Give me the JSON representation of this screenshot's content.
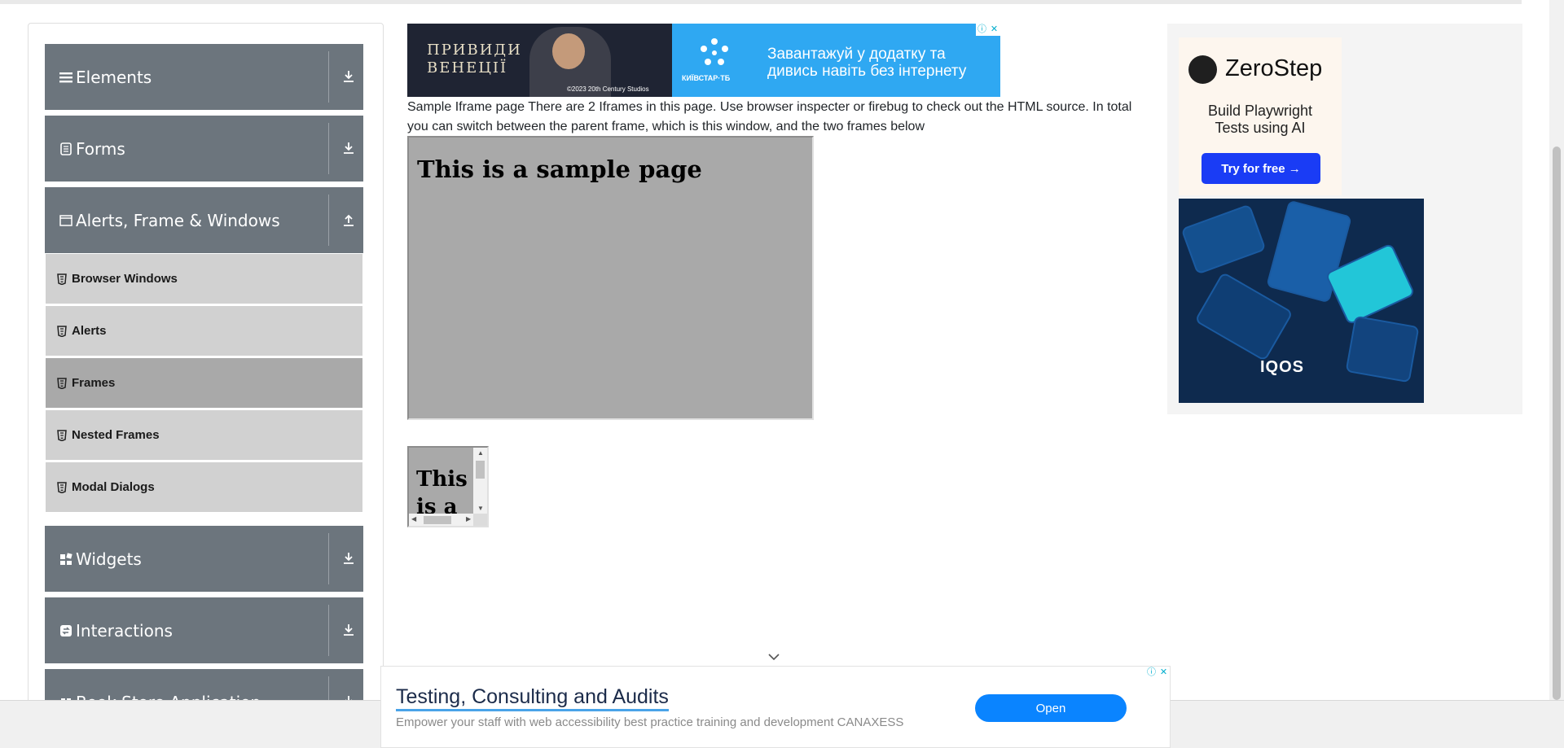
{
  "sidebar": {
    "groups": [
      {
        "label": "Elements",
        "icon": "menu-icon",
        "arrow": "download-icon"
      },
      {
        "label": "Forms",
        "icon": "form-icon",
        "arrow": "download-icon"
      },
      {
        "label": "Alerts, Frame & Windows",
        "icon": "window-icon",
        "arrow": "upload-icon"
      },
      {
        "label": "Widgets",
        "icon": "widgets-icon",
        "arrow": "download-icon"
      },
      {
        "label": "Interactions",
        "icon": "interactions-icon",
        "arrow": "download-icon"
      },
      {
        "label": "Book Store Application",
        "icon": "book-icon",
        "arrow": "download-icon"
      }
    ],
    "items": [
      {
        "label": "Browser Windows",
        "active": false
      },
      {
        "label": "Alerts",
        "active": false
      },
      {
        "label": "Frames",
        "active": true
      },
      {
        "label": "Nested Frames",
        "active": false
      },
      {
        "label": "Modal Dialogs",
        "active": false
      }
    ]
  },
  "top_ad": {
    "movie_title": "ПРИВИДИ ВЕНЕЦІЇ",
    "studio": "©2023 20th Century Studios",
    "brand": "КИЇВСТАР·ТБ",
    "tagline": "Завантажуй у додатку та дивись навіть без інтернету"
  },
  "main": {
    "description": "Sample Iframe page There are 2 Iframes in this page. Use browser inspecter or firebug to check out the HTML source. In total you can switch between the parent frame, which is this window, and the two frames below",
    "frame1_heading": "This is a sample page",
    "frame2_heading": "This is a"
  },
  "right_ad": {
    "brand": "ZeroStep",
    "subtitle": "Build Playwright Tests using AI",
    "cta": "Try for free →",
    "brand2": "IQOS"
  },
  "bottom_ad": {
    "headline": "Testing, Consulting and Audits",
    "description": "Empower your staff with web accessibility best practice training and development CANAXESS",
    "button": "Open"
  },
  "colors": {
    "group_bg": "#6c757d",
    "item_bg": "#d1d1d1",
    "item_active_bg": "#a9a9a9",
    "frame_bg": "#a9a9a9"
  }
}
